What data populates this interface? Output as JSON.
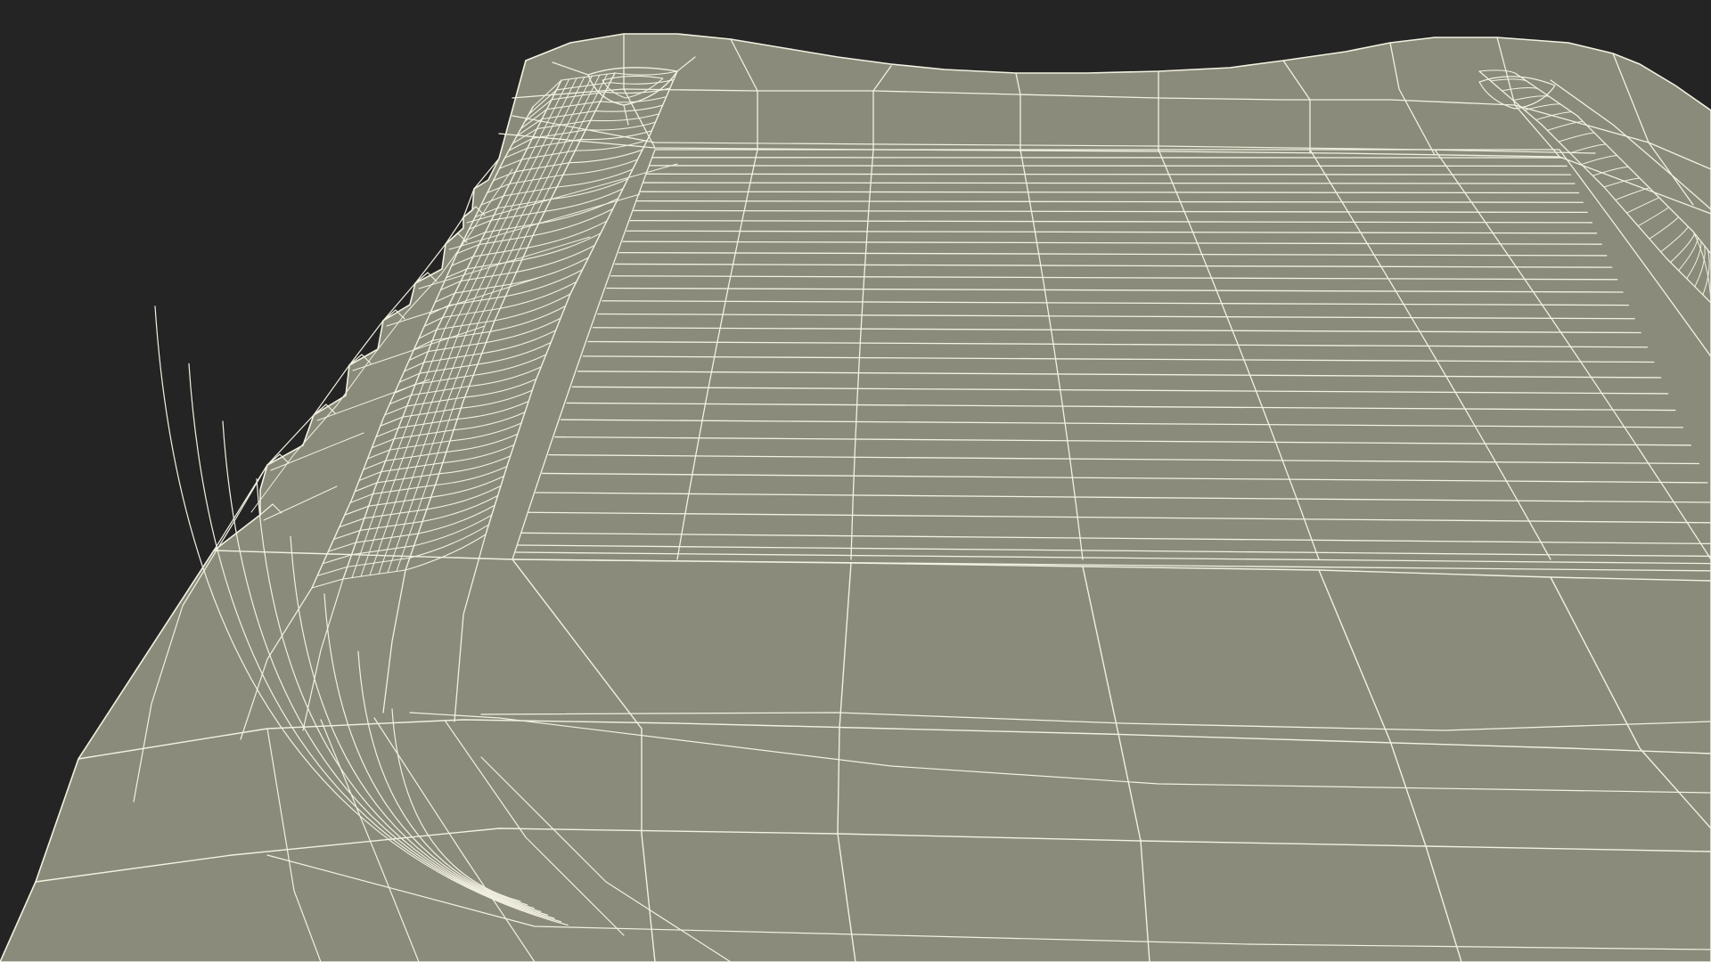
{
  "scene": {
    "background_color": "#242424",
    "surface_color": "#8a8b7a",
    "wire_color": "#f3f1e1",
    "render_mode": "wireframe-on-shaded"
  }
}
